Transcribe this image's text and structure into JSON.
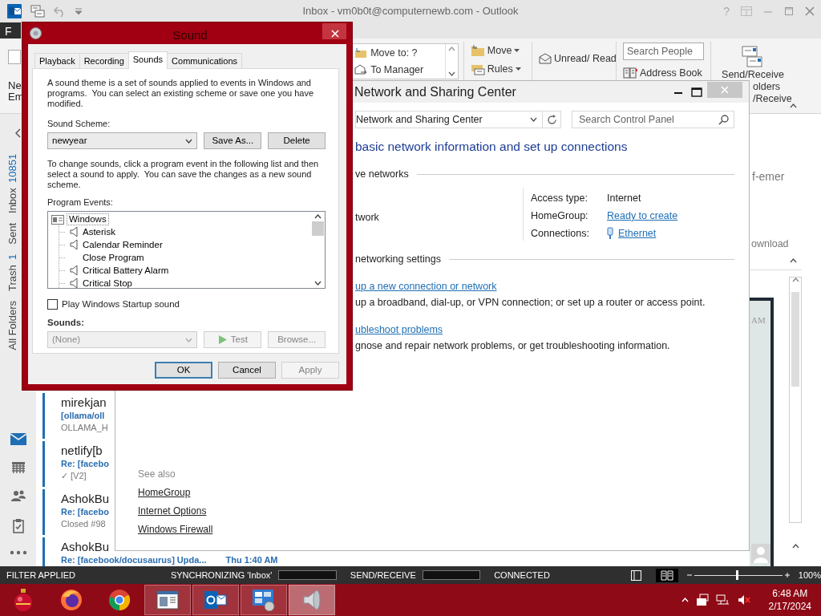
{
  "outlook": {
    "title": "Inbox - vm0b0t@computernewb.com - Outlook",
    "help": "?",
    "file_tab": "F",
    "ribbon": {
      "new_email": [
        "Ne",
        "Em"
      ],
      "quick_steps": [
        "Move to: ?",
        "To Manager"
      ],
      "move": "Move",
      "rules": "Rules",
      "unread_read": "Unread/ Read",
      "search_people": {
        "placeholder": "Search People"
      },
      "address_book": "Address Book",
      "send_receive": {
        "label": "Send/Receive",
        "lines": [
          "olders",
          "/Receive"
        ]
      }
    },
    "folders": [
      {
        "label": "Inbox",
        "count": "10851"
      },
      {
        "label": "Sent"
      },
      {
        "label": "Trash",
        "count": "1"
      },
      {
        "label": "All Folders"
      }
    ],
    "nav": [
      {
        "kind": "mail",
        "selected": true
      },
      {
        "kind": "calendar",
        "selected": false
      },
      {
        "kind": "people",
        "selected": false
      },
      {
        "kind": "tasks",
        "selected": false
      },
      {
        "kind": "more",
        "selected": false
      }
    ],
    "messages": [
      {
        "sender": "mirekjan",
        "subject": "[ollama/oll",
        "preview": "OLLAMA_H"
      },
      {
        "sender": "netlify[b",
        "subject": "Re: [facebo",
        "preview": "✓ [V2]"
      },
      {
        "sender": "AshokBu",
        "subject": "Re: [facebo",
        "preview": "Closed #98"
      },
      {
        "sender": "AshokBu",
        "subject": "Re: [facebook/docusaurus] Upda...",
        "time": "Thu 1:40 AM"
      }
    ],
    "reading_pane": {
      "lines": [
        "f-emer",
        "ownload"
      ],
      "time": "AM"
    },
    "status_bar": {
      "filter": "FILTER APPLIED",
      "sync": "SYNCHRONIZING 'Inbox'",
      "sync_progress": {
        "level": 0
      },
      "send_receive": "SEND/RECEIVE",
      "send_receive_progress": {
        "level": 0
      },
      "connection": "CONNECTED",
      "views": [
        {
          "kind": "normal",
          "selected": false
        },
        {
          "kind": "reading",
          "selected": true
        }
      ],
      "zoom": {
        "level": 0.48,
        "label": "100%"
      }
    }
  },
  "network_window": {
    "title": "Network and Sharing Center",
    "address": "Network and Sharing Center",
    "search": {
      "placeholder": "Search Control Panel"
    },
    "heading": "basic network information and set up connections",
    "active_heading": "ve networks",
    "network_name": "twork",
    "details": [
      {
        "label": "Access type:",
        "value": "Internet",
        "kind": "text"
      },
      {
        "label": "HomeGroup:",
        "value": "Ready to create",
        "kind": "link"
      },
      {
        "label": "Connections:",
        "value": "Ethernet",
        "kind": "connection"
      }
    ],
    "settings_heading": "networking settings",
    "tasks": [
      {
        "link": "up a new connection or network",
        "description": "up a broadband, dial-up, or VPN connection; or set up a router or access point."
      },
      {
        "link": "ubleshoot problems",
        "description": "gnose and repair network problems, or get troubleshooting information."
      }
    ],
    "see_also": {
      "heading": "See also",
      "links": [
        "HomeGroup",
        "Internet Options",
        "Windows Firewall"
      ]
    }
  },
  "sound_dialog": {
    "title": "Sound",
    "tabs": [
      {
        "label": "Playback",
        "selected": false
      },
      {
        "label": "Recording",
        "selected": false
      },
      {
        "label": "Sounds",
        "selected": true
      },
      {
        "label": "Communications",
        "selected": false
      }
    ],
    "description": "A sound theme is a set of sounds applied to events in Windows and programs.  You can select an existing scheme or save one you have modified.",
    "scheme_label": "Sound Scheme:",
    "scheme": "newyear",
    "save_as": "Save As...",
    "delete": "Delete",
    "instructions": "To change sounds, click a program event in the following list and then select a sound to apply.  You can save the changes as a new sound scheme.",
    "events_label": "Program Events:",
    "events": [
      {
        "label": "Windows",
        "children": [
          {
            "label": "Asterisk",
            "has_sound": true
          },
          {
            "label": "Calendar Reminder",
            "has_sound": true
          },
          {
            "label": "Close Program",
            "has_sound": false
          },
          {
            "label": "Critical Battery Alarm",
            "has_sound": true
          },
          {
            "label": "Critical Stop",
            "has_sound": true
          }
        ]
      }
    ],
    "startup_sound": {
      "label": "Play Windows Startup sound",
      "checked": false
    },
    "sounds_label": "Sounds:",
    "sound": {
      "value": "(None)",
      "disabled": true
    },
    "test": {
      "label": "Test",
      "disabled": true
    },
    "browse": {
      "label": "Browse...",
      "disabled": true
    },
    "buttons": [
      {
        "label": "OK",
        "disabled": false,
        "default": true
      },
      {
        "label": "Cancel",
        "disabled": false,
        "default": false
      },
      {
        "label": "Apply",
        "disabled": true,
        "default": false
      }
    ]
  },
  "taskbar": {
    "apps": [
      {
        "kind": "ornament",
        "running": false,
        "selected": false
      },
      {
        "kind": "firefox",
        "running": false,
        "selected": false
      },
      {
        "kind": "chrome",
        "running": false,
        "selected": false
      },
      {
        "kind": "presentation",
        "running": true,
        "selected": false
      },
      {
        "kind": "outlook",
        "running": true,
        "selected": false
      },
      {
        "kind": "control-panel",
        "running": true,
        "selected": false
      },
      {
        "kind": "speaker",
        "running": true,
        "selected": true
      }
    ],
    "tray": {
      "muted": true,
      "time": "6:48 AM",
      "date": "2/17/2024"
    }
  }
}
